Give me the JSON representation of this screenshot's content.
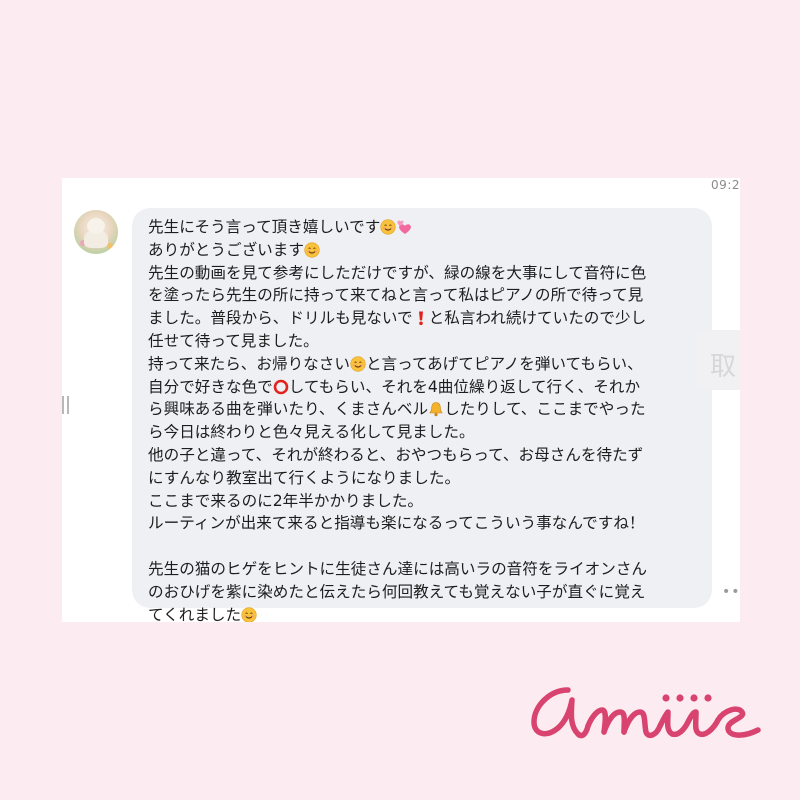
{
  "status_time": "09:2",
  "chat_message": {
    "sender_avatar_icon": "dog-avatar-icon",
    "lines": [
      "先生にそう言って頂き嬉しいです",
      "ありがとうございます",
      "先生の動画を見て参考にしただけですが、緑の線を大事にして音符に色",
      "を塗ったら先生の所に持って来てねと言って私はピアノの所で待って見",
      "ました。普段から、ドリルも見ないで",
      "と私言われ続けていたので少し",
      "任せて待って見ました。",
      "持って来たら、お帰りなさい",
      "と言ってあげてピアノを弾いてもらい、",
      "自分で好きな色で",
      "してもらい、それを4曲位繰り返して行く、それか",
      "ら興味ある曲を弾いたり、くまさんベル",
      "したりして、ここまでやった",
      "ら今日は終わりと色々見える化して見ました。",
      "他の子と違って、それが終わると、おやつもらって、お母さんを待たず",
      "にすんなり教室出て行くようになりました。",
      "ここまで来るのに2年半かかりました。",
      "ルーティンが出来て来ると指導も楽になるってこういう事なんですね！",
      "先生の猫のヒゲをヒントに生徒さん達には高いラの音符をライオンさん",
      "のおひげを紫に染めたと伝えたら何回教えても覚えない子が直ぐに覚え",
      "てくれました"
    ],
    "emoji": {
      "smile": "smiling-face-icon",
      "hearts": "two-hearts-icon",
      "exclamation": "red-exclamation-icon",
      "circle": "red-circle-icon",
      "bell": "bell-icon"
    }
  },
  "side_button_label": "取",
  "handle_icon": "drag-handle-icon",
  "more_icon": "more-dots-icon",
  "brand": {
    "logo_text": "amiis",
    "logo_color": "#d8436f"
  },
  "colors": {
    "page_background": "#fcecf1",
    "bubble_background": "#eff0f4"
  }
}
